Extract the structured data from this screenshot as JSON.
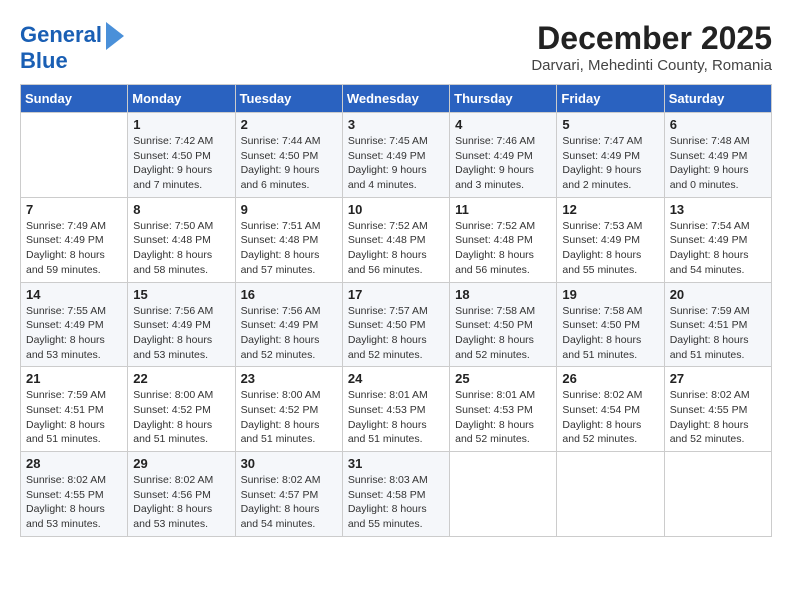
{
  "logo": {
    "line1": "General",
    "line2": "Blue"
  },
  "title": "December 2025",
  "subtitle": "Darvari, Mehedinti County, Romania",
  "days_of_week": [
    "Sunday",
    "Monday",
    "Tuesday",
    "Wednesday",
    "Thursday",
    "Friday",
    "Saturday"
  ],
  "weeks": [
    [
      {
        "num": "",
        "info": ""
      },
      {
        "num": "1",
        "info": "Sunrise: 7:42 AM\nSunset: 4:50 PM\nDaylight: 9 hours\nand 7 minutes."
      },
      {
        "num": "2",
        "info": "Sunrise: 7:44 AM\nSunset: 4:50 PM\nDaylight: 9 hours\nand 6 minutes."
      },
      {
        "num": "3",
        "info": "Sunrise: 7:45 AM\nSunset: 4:49 PM\nDaylight: 9 hours\nand 4 minutes."
      },
      {
        "num": "4",
        "info": "Sunrise: 7:46 AM\nSunset: 4:49 PM\nDaylight: 9 hours\nand 3 minutes."
      },
      {
        "num": "5",
        "info": "Sunrise: 7:47 AM\nSunset: 4:49 PM\nDaylight: 9 hours\nand 2 minutes."
      },
      {
        "num": "6",
        "info": "Sunrise: 7:48 AM\nSunset: 4:49 PM\nDaylight: 9 hours\nand 0 minutes."
      }
    ],
    [
      {
        "num": "7",
        "info": "Sunrise: 7:49 AM\nSunset: 4:49 PM\nDaylight: 8 hours\nand 59 minutes."
      },
      {
        "num": "8",
        "info": "Sunrise: 7:50 AM\nSunset: 4:48 PM\nDaylight: 8 hours\nand 58 minutes."
      },
      {
        "num": "9",
        "info": "Sunrise: 7:51 AM\nSunset: 4:48 PM\nDaylight: 8 hours\nand 57 minutes."
      },
      {
        "num": "10",
        "info": "Sunrise: 7:52 AM\nSunset: 4:48 PM\nDaylight: 8 hours\nand 56 minutes."
      },
      {
        "num": "11",
        "info": "Sunrise: 7:52 AM\nSunset: 4:48 PM\nDaylight: 8 hours\nand 56 minutes."
      },
      {
        "num": "12",
        "info": "Sunrise: 7:53 AM\nSunset: 4:49 PM\nDaylight: 8 hours\nand 55 minutes."
      },
      {
        "num": "13",
        "info": "Sunrise: 7:54 AM\nSunset: 4:49 PM\nDaylight: 8 hours\nand 54 minutes."
      }
    ],
    [
      {
        "num": "14",
        "info": "Sunrise: 7:55 AM\nSunset: 4:49 PM\nDaylight: 8 hours\nand 53 minutes."
      },
      {
        "num": "15",
        "info": "Sunrise: 7:56 AM\nSunset: 4:49 PM\nDaylight: 8 hours\nand 53 minutes."
      },
      {
        "num": "16",
        "info": "Sunrise: 7:56 AM\nSunset: 4:49 PM\nDaylight: 8 hours\nand 52 minutes."
      },
      {
        "num": "17",
        "info": "Sunrise: 7:57 AM\nSunset: 4:50 PM\nDaylight: 8 hours\nand 52 minutes."
      },
      {
        "num": "18",
        "info": "Sunrise: 7:58 AM\nSunset: 4:50 PM\nDaylight: 8 hours\nand 52 minutes."
      },
      {
        "num": "19",
        "info": "Sunrise: 7:58 AM\nSunset: 4:50 PM\nDaylight: 8 hours\nand 51 minutes."
      },
      {
        "num": "20",
        "info": "Sunrise: 7:59 AM\nSunset: 4:51 PM\nDaylight: 8 hours\nand 51 minutes."
      }
    ],
    [
      {
        "num": "21",
        "info": "Sunrise: 7:59 AM\nSunset: 4:51 PM\nDaylight: 8 hours\nand 51 minutes."
      },
      {
        "num": "22",
        "info": "Sunrise: 8:00 AM\nSunset: 4:52 PM\nDaylight: 8 hours\nand 51 minutes."
      },
      {
        "num": "23",
        "info": "Sunrise: 8:00 AM\nSunset: 4:52 PM\nDaylight: 8 hours\nand 51 minutes."
      },
      {
        "num": "24",
        "info": "Sunrise: 8:01 AM\nSunset: 4:53 PM\nDaylight: 8 hours\nand 51 minutes."
      },
      {
        "num": "25",
        "info": "Sunrise: 8:01 AM\nSunset: 4:53 PM\nDaylight: 8 hours\nand 52 minutes."
      },
      {
        "num": "26",
        "info": "Sunrise: 8:02 AM\nSunset: 4:54 PM\nDaylight: 8 hours\nand 52 minutes."
      },
      {
        "num": "27",
        "info": "Sunrise: 8:02 AM\nSunset: 4:55 PM\nDaylight: 8 hours\nand 52 minutes."
      }
    ],
    [
      {
        "num": "28",
        "info": "Sunrise: 8:02 AM\nSunset: 4:55 PM\nDaylight: 8 hours\nand 53 minutes."
      },
      {
        "num": "29",
        "info": "Sunrise: 8:02 AM\nSunset: 4:56 PM\nDaylight: 8 hours\nand 53 minutes."
      },
      {
        "num": "30",
        "info": "Sunrise: 8:02 AM\nSunset: 4:57 PM\nDaylight: 8 hours\nand 54 minutes."
      },
      {
        "num": "31",
        "info": "Sunrise: 8:03 AM\nSunset: 4:58 PM\nDaylight: 8 hours\nand 55 minutes."
      },
      {
        "num": "",
        "info": ""
      },
      {
        "num": "",
        "info": ""
      },
      {
        "num": "",
        "info": ""
      }
    ]
  ]
}
